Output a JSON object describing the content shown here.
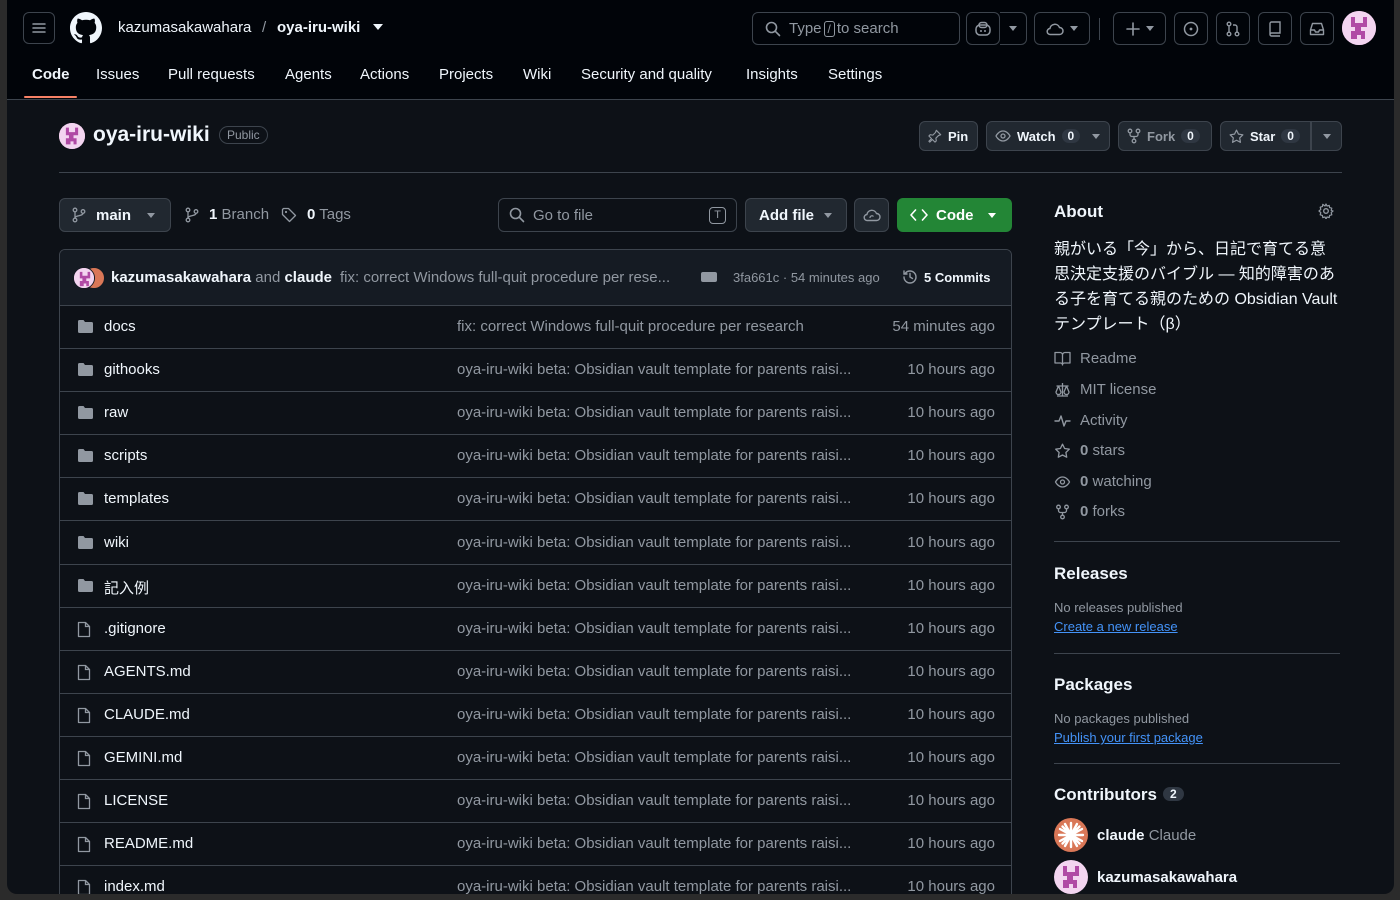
{
  "header": {
    "owner": "kazumasakawahara",
    "separator": "/",
    "repo": "oya-iru-wiki",
    "search_pre": "Type",
    "search_key": "/",
    "search_post": "to search"
  },
  "tabs": [
    {
      "label": "Code",
      "active": true
    },
    {
      "label": "Issues"
    },
    {
      "label": "Pull requests"
    },
    {
      "label": "Agents"
    },
    {
      "label": "Actions"
    },
    {
      "label": "Projects"
    },
    {
      "label": "Wiki"
    },
    {
      "label": "Security and quality"
    },
    {
      "label": "Insights"
    },
    {
      "label": "Settings"
    }
  ],
  "repo": {
    "name": "oya-iru-wiki",
    "visibility": "Public",
    "pin_label": "Pin",
    "watch_label": "Watch",
    "watch_count": "0",
    "fork_label": "Fork",
    "fork_count": "0",
    "star_label": "Star",
    "star_count": "0"
  },
  "toolbar": {
    "branch": "main",
    "branch_count": "1",
    "branch_label": "Branch",
    "tag_count": "0",
    "tag_label": "Tags",
    "goto_placeholder": "Go to file",
    "goto_key": "T",
    "add_file": "Add file",
    "code": "Code"
  },
  "latest_commit": {
    "author1": "kazumasakawahara",
    "and": "and",
    "author2": "claude",
    "message": "fix: correct Windows full-quit procedure per rese...",
    "hash_time": "3fa661c · 54 minutes ago",
    "commits": "5 Commits"
  },
  "files": [
    {
      "type": "dir",
      "name": "docs",
      "message": "fix: correct Windows full-quit procedure per research",
      "time": "54 minutes ago"
    },
    {
      "type": "dir",
      "name": "githooks",
      "message": "oya-iru-wiki beta: Obsidian vault template for parents raisi...",
      "time": "10 hours ago"
    },
    {
      "type": "dir",
      "name": "raw",
      "message": "oya-iru-wiki beta: Obsidian vault template for parents raisi...",
      "time": "10 hours ago"
    },
    {
      "type": "dir",
      "name": "scripts",
      "message": "oya-iru-wiki beta: Obsidian vault template for parents raisi...",
      "time": "10 hours ago"
    },
    {
      "type": "dir",
      "name": "templates",
      "message": "oya-iru-wiki beta: Obsidian vault template for parents raisi...",
      "time": "10 hours ago"
    },
    {
      "type": "dir",
      "name": "wiki",
      "message": "oya-iru-wiki beta: Obsidian vault template for parents raisi...",
      "time": "10 hours ago"
    },
    {
      "type": "dir",
      "name": "記入例",
      "message": "oya-iru-wiki beta: Obsidian vault template for parents raisi...",
      "time": "10 hours ago"
    },
    {
      "type": "file",
      "name": ".gitignore",
      "message": "oya-iru-wiki beta: Obsidian vault template for parents raisi...",
      "time": "10 hours ago"
    },
    {
      "type": "file",
      "name": "AGENTS.md",
      "message": "oya-iru-wiki beta: Obsidian vault template for parents raisi...",
      "time": "10 hours ago"
    },
    {
      "type": "file",
      "name": "CLAUDE.md",
      "message": "oya-iru-wiki beta: Obsidian vault template for parents raisi...",
      "time": "10 hours ago"
    },
    {
      "type": "file",
      "name": "GEMINI.md",
      "message": "oya-iru-wiki beta: Obsidian vault template for parents raisi...",
      "time": "10 hours ago"
    },
    {
      "type": "file",
      "name": "LICENSE",
      "message": "oya-iru-wiki beta: Obsidian vault template for parents raisi...",
      "time": "10 hours ago"
    },
    {
      "type": "file",
      "name": "README.md",
      "message": "oya-iru-wiki beta: Obsidian vault template for parents raisi...",
      "time": "10 hours ago"
    },
    {
      "type": "file",
      "name": "index.md",
      "message": "oya-iru-wiki beta: Obsidian vault template for parents raisi...",
      "time": "10 hours ago"
    }
  ],
  "about": {
    "title": "About",
    "description": "親がいる「今」から、日記で育てる意思決定支援のバイブル ― 知的障害のある子を育てる親のための Obsidian Vault テンプレート（β）",
    "readme": "Readme",
    "license": "MIT license",
    "activity": "Activity",
    "stars_count": "0",
    "stars_label": "stars",
    "watching_count": "0",
    "watching_label": "watching",
    "forks_count": "0",
    "forks_label": "forks"
  },
  "releases": {
    "title": "Releases",
    "none": "No releases published",
    "link": "Create a new release"
  },
  "packages": {
    "title": "Packages",
    "none": "No packages published",
    "link": "Publish your first package"
  },
  "contributors": {
    "title": "Contributors",
    "count": "2",
    "list": [
      {
        "login": "claude",
        "name": "Claude"
      },
      {
        "login": "kazumasakawahara",
        "name": ""
      }
    ]
  },
  "colors": {
    "background": "#0d1117",
    "header": "#010409",
    "border": "#3d444d",
    "accent_green": "#238636",
    "link_blue": "#4493f8",
    "tab_underline": "#f78166"
  }
}
